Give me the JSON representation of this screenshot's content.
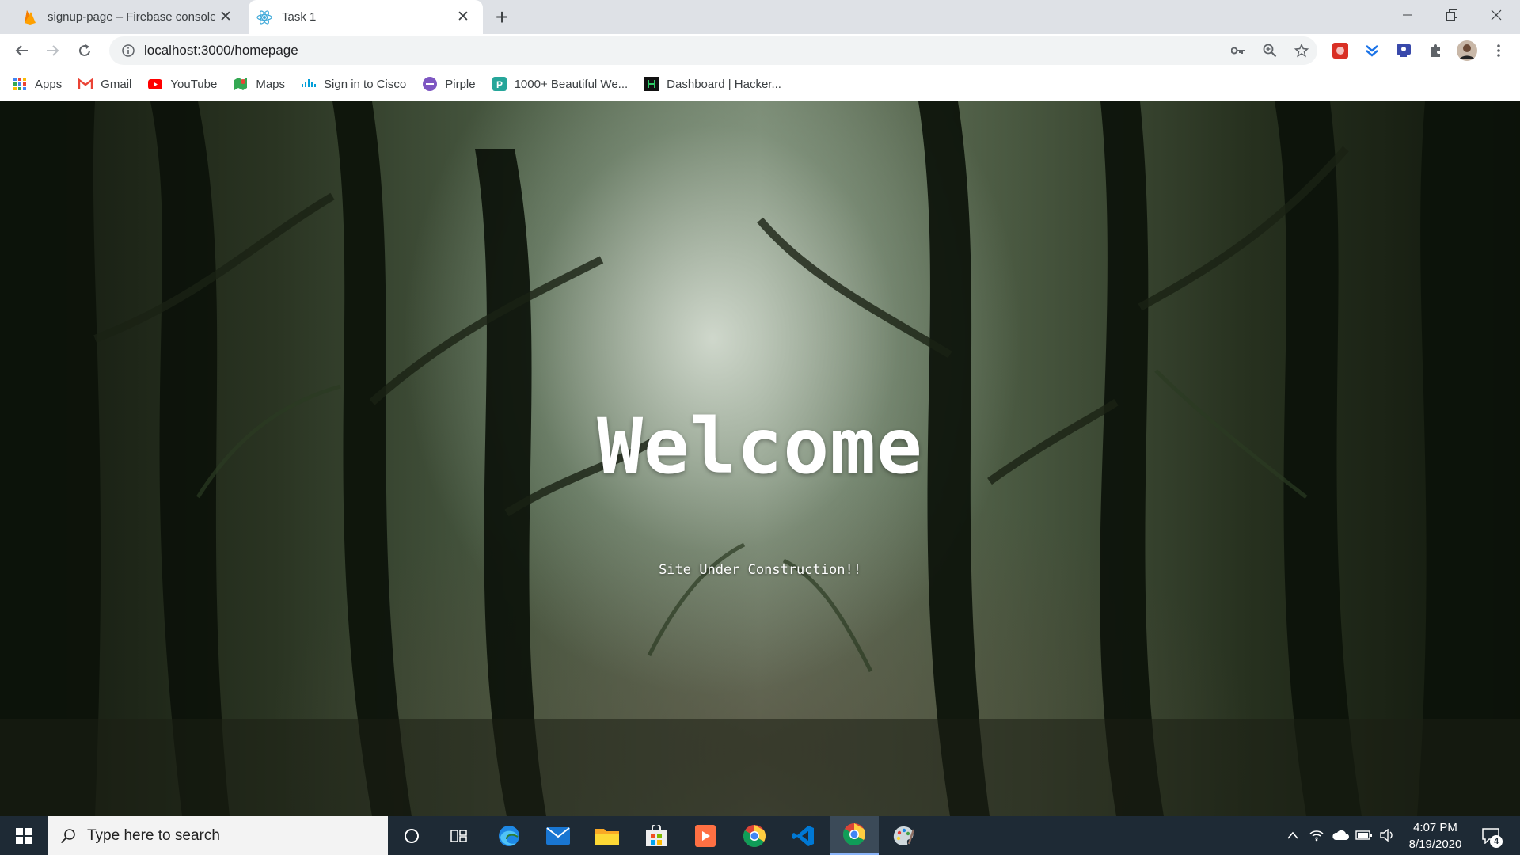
{
  "browser": {
    "tabs": [
      {
        "title": "signup-page – Firebase console",
        "icon": "firebase-icon",
        "active": false
      },
      {
        "title": "Task 1",
        "icon": "react-icon",
        "active": true
      }
    ],
    "url": "localhost:3000/homepage",
    "bookmarks": [
      {
        "label": "Apps",
        "icon": "apps-grid-icon"
      },
      {
        "label": "Gmail",
        "icon": "gmail-icon"
      },
      {
        "label": "YouTube",
        "icon": "youtube-icon"
      },
      {
        "label": "Maps",
        "icon": "maps-icon"
      },
      {
        "label": "Sign in to Cisco",
        "icon": "cisco-icon"
      },
      {
        "label": "Pirple",
        "icon": "pirple-icon"
      },
      {
        "label": "1000+ Beautiful We...",
        "icon": "p-icon"
      },
      {
        "label": "Dashboard | Hacker...",
        "icon": "hackerrank-icon"
      }
    ]
  },
  "page": {
    "title": "Welcome",
    "subtitle": "Site Under Construction!!"
  },
  "taskbar": {
    "search_placeholder": "Type here to search",
    "time": "4:07 PM",
    "date": "8/19/2020",
    "notification_count": "4"
  },
  "colors": {
    "tabstrip": "#dee1e6",
    "taskbar": "#1e2a35",
    "forest_dark": "#13190f",
    "text_white": "#ffffff"
  }
}
